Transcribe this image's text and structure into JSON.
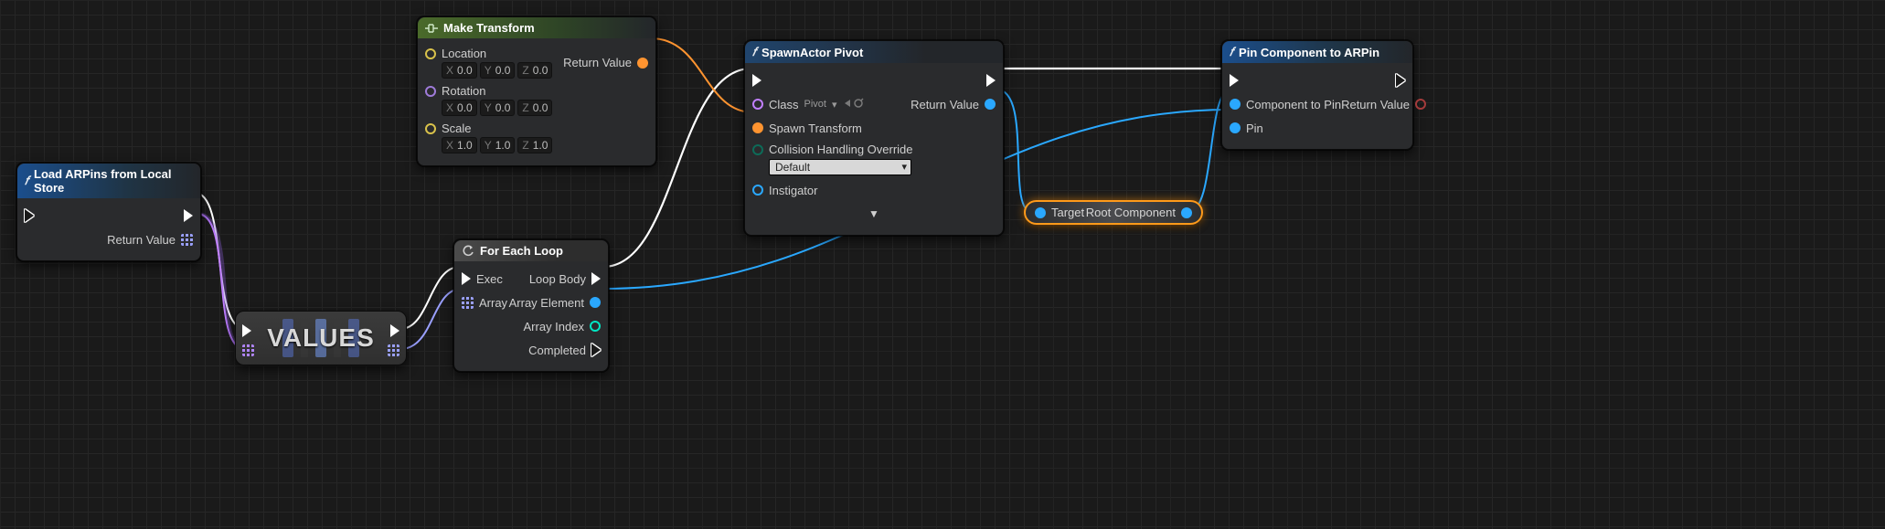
{
  "nodes": {
    "load_arpins": {
      "title": "Load ARPins from Local Store",
      "return_label": "Return Value"
    },
    "make_transform": {
      "title": "Make Transform",
      "location_label": "Location",
      "rotation_label": "Rotation",
      "scale_label": "Scale",
      "return_label": "Return Value",
      "loc": {
        "x": "0.0",
        "y": "0.0",
        "z": "0.0"
      },
      "rot": {
        "x": "0.0",
        "y": "0.0",
        "z": "0.0"
      },
      "scl": {
        "x": "1.0",
        "y": "1.0",
        "z": "1.0"
      }
    },
    "values_node": {
      "label": "VALUES"
    },
    "foreach": {
      "title": "For Each Loop",
      "exec_label": "Exec",
      "array_label": "Array",
      "loopbody_label": "Loop Body",
      "element_label": "Array Element",
      "index_label": "Array Index",
      "completed_label": "Completed"
    },
    "spawn": {
      "title": "SpawnActor Pivot",
      "class_label": "Class",
      "class_value": "Pivot",
      "transform_label": "Spawn Transform",
      "collision_label": "Collision Handling Override",
      "collision_value": "Default",
      "instigator_label": "Instigator",
      "return_label": "Return Value"
    },
    "reroute": {
      "target": "Target",
      "root": "Root Component"
    },
    "pincomp": {
      "title": "Pin Component to ARPin",
      "comp_label": "Component to Pin",
      "pin_label": "Pin",
      "return_label": "Return Value"
    }
  }
}
